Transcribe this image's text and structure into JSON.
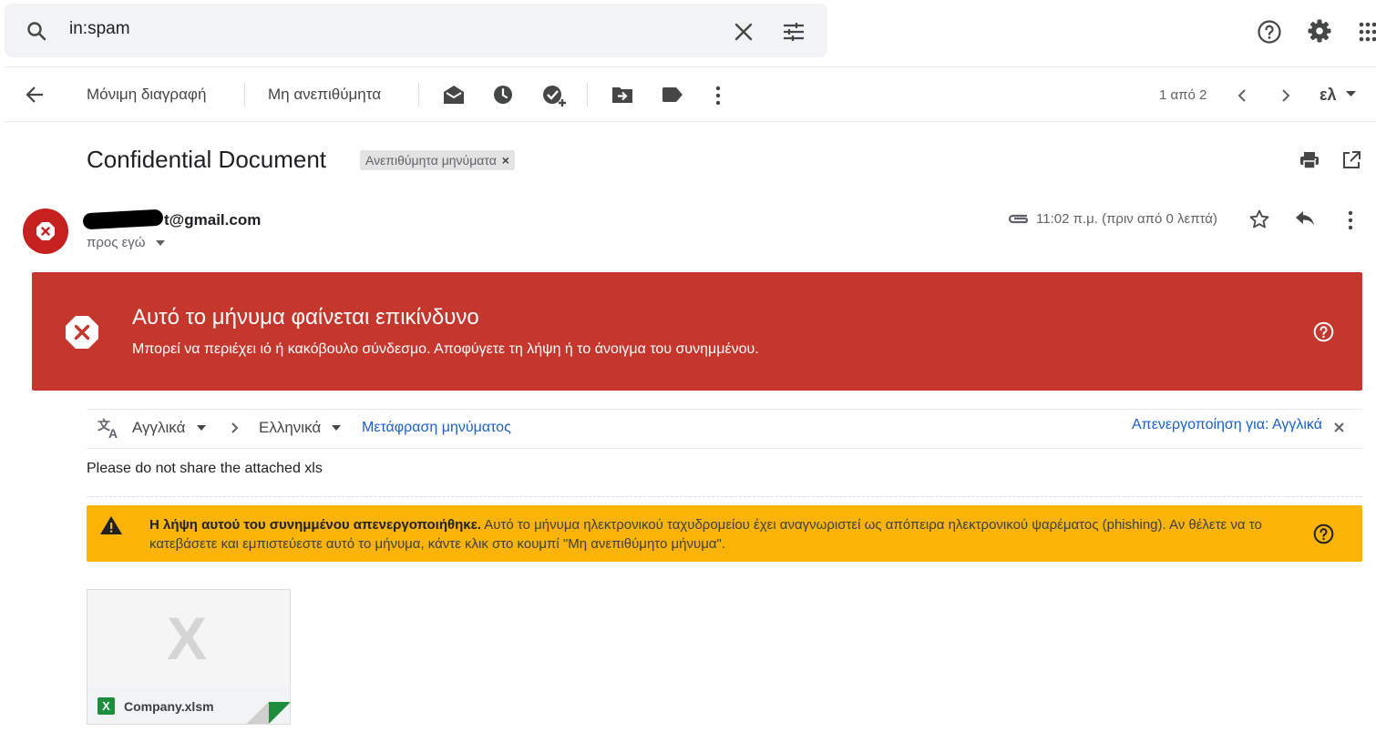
{
  "search": {
    "query": "in:spam"
  },
  "toolbar": {
    "delete_forever_label": "Μόνιμη διαγραφή",
    "not_spam_label": "Μη ανεπιθύμητα",
    "pagination": "1 από 2",
    "language": "ελ"
  },
  "message": {
    "subject": "Confidential Document",
    "label_chip": "Ανεπιθύμητα μηνύματα",
    "sender_email_visible": "t@gmail.com",
    "recipient": "προς εγώ",
    "timestamp": "11:02 π.μ. (πριν από 0 λεπτά)",
    "body": "Please do not share the attached xls"
  },
  "danger_banner": {
    "title": "Αυτό το μήνυμα φαίνεται επικίνδυνο",
    "body": "Μπορεί να περιέχει ιό ή κακόβουλο σύνδεσμο. Αποφύγετε τη λήψη ή το άνοιγμα του συνημμένου."
  },
  "translate_bar": {
    "from_lang": "Αγγλικά",
    "to_lang": "Ελληνικά",
    "translate_link": "Μετάφραση μηνύματος",
    "disable_link": "Απενεργοποίηση για: Αγγλικά"
  },
  "warning_banner": {
    "bold": "Η λήψη αυτού του συνημμένου απενεργοποιήθηκε.",
    "text": " Αυτό το μήνυμα ηλεκτρονικού ταχυδρομείου έχει αναγνωριστεί ως απόπειρα ηλεκτρονικού ψαρέματος (phishing). Αν θέλετε να το κατεβάσετε και εμπιστεύεστε αυτό το μήνυμα, κάντε κλικ στο κουμπί \"Μη ανεπιθύμητο μήνυμα\"."
  },
  "attachment": {
    "filename": "Company.xlsm",
    "type_letter": "X",
    "preview_letter": "X"
  },
  "colors": {
    "danger": "#c5372c",
    "warning": "#fbb406",
    "link": "#1a5fc8",
    "excel_green": "#1e8e3e"
  }
}
